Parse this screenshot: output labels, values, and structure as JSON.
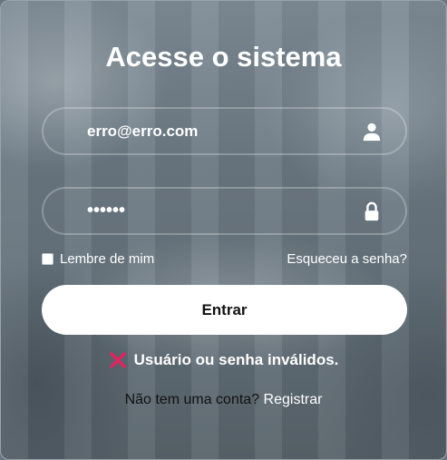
{
  "form": {
    "title": "Acesse o sistema",
    "email": {
      "value": "erro@erro.com",
      "icon": "user-icon"
    },
    "password": {
      "value": "••••••",
      "icon": "lock-icon"
    },
    "remember_label": "Lembre de mim",
    "remember_checked": false,
    "forgot_label": "Esqueceu a senha?",
    "submit_label": "Entrar",
    "error": {
      "icon": "x-icon",
      "text": "Usuário ou senha inválidos."
    },
    "register": {
      "question": "Não tem uma conta?",
      "link_label": "Registrar"
    }
  },
  "colors": {
    "error_icon": "#e0245e",
    "text": "#ffffff",
    "button_bg": "#ffffff",
    "button_text": "#111111"
  }
}
